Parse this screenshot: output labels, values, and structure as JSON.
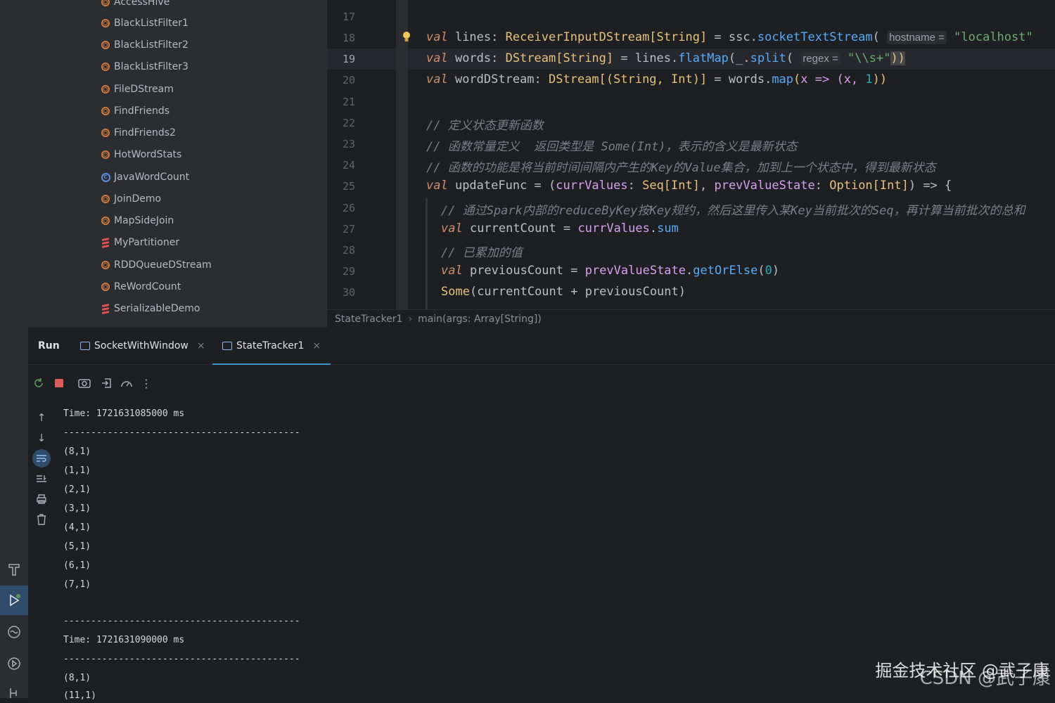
{
  "project_tree": {
    "items": [
      {
        "label": "AccessHive",
        "icon": "object-icon"
      },
      {
        "label": "BlackListFilter1",
        "icon": "object-icon"
      },
      {
        "label": "BlackListFilter2",
        "icon": "object-icon"
      },
      {
        "label": "BlackListFilter3",
        "icon": "object-icon"
      },
      {
        "label": "FileDStream",
        "icon": "object-icon"
      },
      {
        "label": "FindFriends",
        "icon": "object-icon"
      },
      {
        "label": "FindFriends2",
        "icon": "object-icon"
      },
      {
        "label": "HotWordStats",
        "icon": "object-icon"
      },
      {
        "label": "JavaWordCount",
        "icon": "class-icon"
      },
      {
        "label": "JoinDemo",
        "icon": "object-icon"
      },
      {
        "label": "MapSideJoin",
        "icon": "object-icon"
      },
      {
        "label": "MyPartitioner",
        "icon": "scala-file-icon"
      },
      {
        "label": "RDDQueueDStream",
        "icon": "object-icon"
      },
      {
        "label": "ReWordCount",
        "icon": "object-icon"
      },
      {
        "label": "SerializableDemo",
        "icon": "scala-file-icon"
      }
    ]
  },
  "editor": {
    "line_numbers": [
      "17",
      "18",
      "19",
      "20",
      "21",
      "22",
      "23",
      "24",
      "25",
      "26",
      "27",
      "28",
      "29",
      "30"
    ],
    "current_line": "19",
    "line18": {
      "kw": "val",
      "name": " lines: ",
      "type": "ReceiverInputDStream[String]",
      "eq": " = ssc.",
      "fn": "socketTextStream",
      "open": "( ",
      "hint": "hostname =",
      "str": " \"localhost\""
    },
    "line19": {
      "kw": "val",
      "name": " words: ",
      "type": "DStream[String]",
      "eq": " = lines.",
      "fn": "flatMap",
      "open": "(",
      "p1": "_.",
      "fn2": "split",
      "open2": "( ",
      "hint": "regex =",
      "str": " \"\\\\s+\"",
      "close": "))"
    },
    "line20": {
      "kw": "val",
      "name": " wordDStream: ",
      "type": "DStream[(String, Int)]",
      "eq": " = words.",
      "fn": "map",
      "open": "(",
      "p": "x => (x, ",
      "num": "1",
      "close": "))"
    },
    "line22": "// 定义状态更新函数",
    "line23a": "// 函数常量定义  返回类型是 ",
    "line23b": "Some(Int)",
    "line23c": "，表示的含义是最新状态",
    "line24": "// 函数的功能是将当前时间间隔内产生的Key的Value集合，加到上一个状态中，得到最新状态",
    "line25": {
      "kw": "val",
      "name": " updateFunc = (",
      "p1": "currValues",
      "c1": ": ",
      "t1": "Seq[Int]",
      "c2": ", ",
      "p2": "prevValueState",
      "c3": ": ",
      "t2": "Option[Int]",
      "end": ") => {"
    },
    "line26": "// 通过Spark内部的reduceByKey按Key规约，然后这里传入某Key当前批次的Seq，再计算当前批次的总和",
    "line27": {
      "kw": "val",
      "name": " currentCount = ",
      "p": "currValues",
      "dot": ".",
      "fn": "sum"
    },
    "line28": "// 已累加的值",
    "line29": {
      "kw": "val",
      "name": " previousCount = ",
      "p": "prevValueState",
      "dot": ".",
      "fn": "getOrElse",
      "open": "(",
      "num": "0",
      "close": ")"
    },
    "line30": {
      "some": "Some",
      "rest": "(currentCount + previousCount)"
    }
  },
  "breadcrumb": {
    "file": "StateTracker1",
    "method": "main(args: Array[String])"
  },
  "run_panel": {
    "title": "Run",
    "tabs": [
      {
        "label": "SocketWithWindow",
        "active": false
      },
      {
        "label": "StateTracker1",
        "active": true
      }
    ]
  },
  "console": {
    "lines": [
      "Time: 1721631085000 ms",
      "-------------------------------------------",
      "(8,1)",
      "(1,1)",
      "(2,1)",
      "(3,1)",
      "(4,1)",
      "(5,1)",
      "(6,1)",
      "(7,1)",
      "",
      "-------------------------------------------",
      "Time: 1721631090000 ms",
      "-------------------------------------------",
      "(8,1)",
      "(11,1)"
    ]
  },
  "watermark": {
    "line1": "掘金技术社区 @武子康",
    "line2": "CSDN @武子康"
  },
  "colors": {
    "accent": "#3592c4",
    "keyword": "#cf8e6d",
    "type": "#e6c17a",
    "function": "#57aaf7",
    "string": "#6aab73",
    "number": "#2aacb8"
  }
}
